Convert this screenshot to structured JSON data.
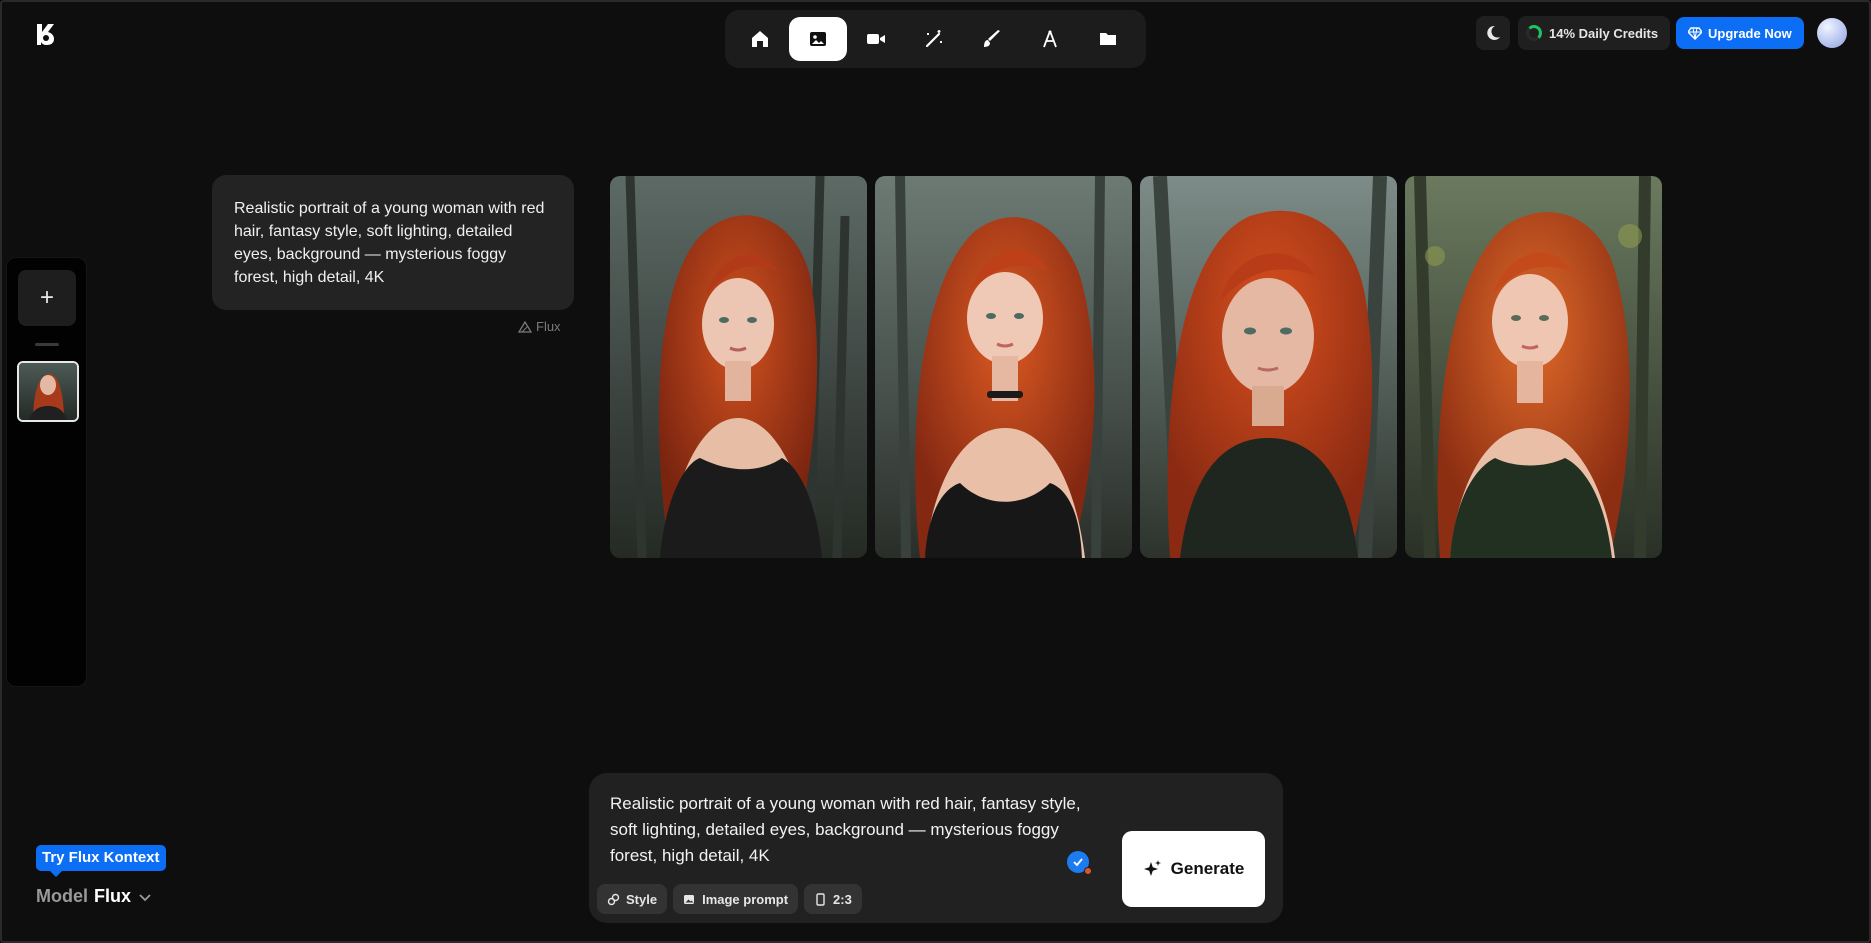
{
  "nav": {
    "items": [
      {
        "name": "home",
        "icon": "home-icon",
        "active": false
      },
      {
        "name": "image",
        "icon": "image-icon",
        "active": true
      },
      {
        "name": "video",
        "icon": "video-icon",
        "active": false
      },
      {
        "name": "magic",
        "icon": "magic-wand-icon",
        "active": false
      },
      {
        "name": "edit",
        "icon": "brush-icon",
        "active": false
      },
      {
        "name": "text",
        "icon": "text-pen-icon",
        "active": false
      },
      {
        "name": "folder",
        "icon": "folder-icon",
        "active": false
      }
    ]
  },
  "header": {
    "credits_label": "14% Daily Credits",
    "credits_progress": 0.14,
    "upgrade_label": "Upgrade Now"
  },
  "history": {
    "new_label": "+"
  },
  "conversation": {
    "prompt": "Realistic portrait of a young woman with red hair, fantasy style, soft lighting, detailed eyes, background — mysterious foggy forest, high detail, 4K",
    "model_tag": "Flux"
  },
  "composer": {
    "text": "Realistic portrait of a young woman with red hair, fantasy style, soft lighting, detailed eyes, background — mysterious foggy forest, high detail, 4K",
    "generate_label": "Generate",
    "chips": {
      "style": "Style",
      "image_prompt": "Image prompt",
      "ratio": "2:3"
    }
  },
  "model": {
    "promo": "Try Flux Kontext",
    "label": "Model",
    "value": "Flux"
  },
  "colors": {
    "accent": "#0b6ef5",
    "background": "#0e0e0e",
    "credits_ring": "#21c065"
  }
}
